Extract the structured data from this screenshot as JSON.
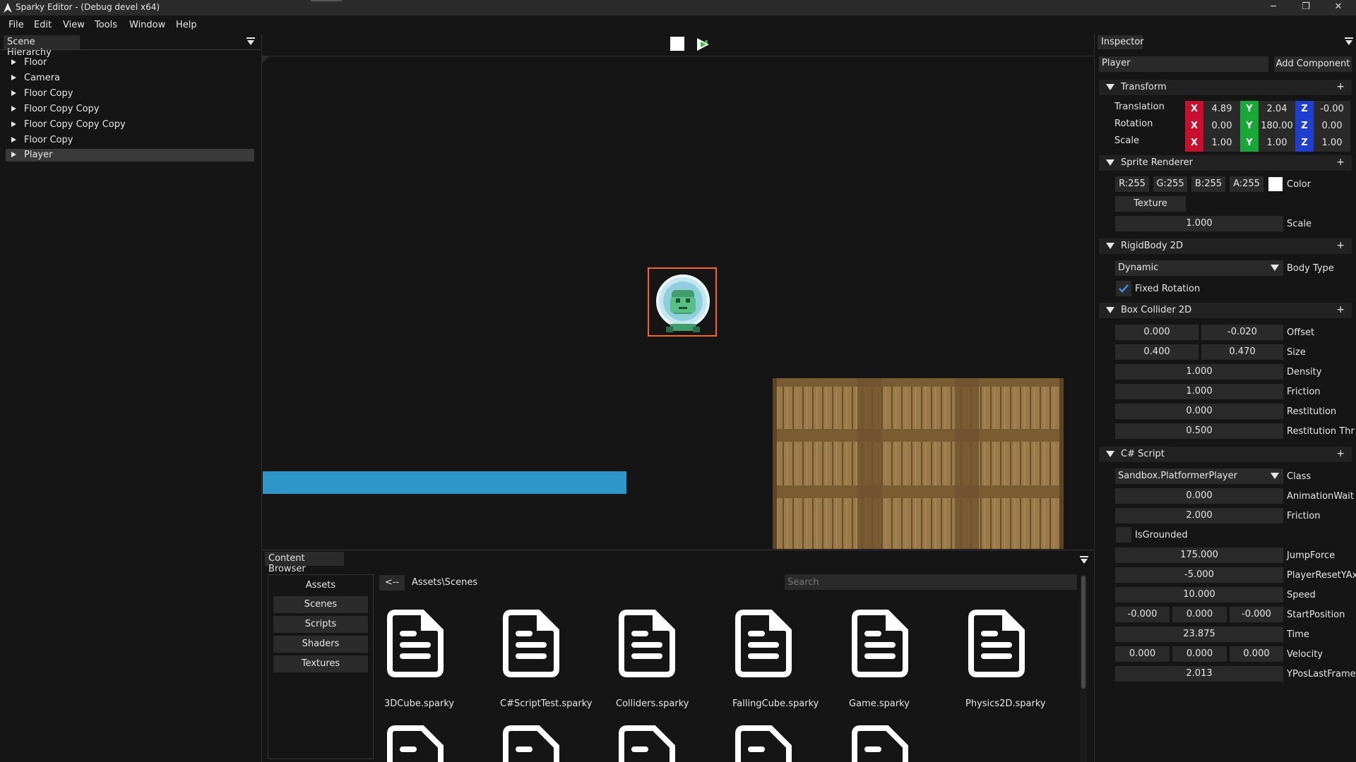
{
  "window": {
    "title": "Sparky Editor - (Debug devel x64)",
    "minimize": "─",
    "restore": "❐",
    "close": "✕"
  },
  "menu": {
    "items": [
      "File",
      "Edit",
      "View",
      "Tools",
      "Window",
      "Help"
    ]
  },
  "hierarchy": {
    "title": "Scene Hierarchy",
    "items": [
      "Floor",
      "Camera",
      "Floor Copy",
      "Floor Copy Copy",
      "Floor Copy Copy Copy",
      "Floor Copy",
      "Player"
    ],
    "selected": "Player"
  },
  "toolbar": {
    "stop_icon": "stop-icon",
    "play_icon": "simulate-icon"
  },
  "inspector": {
    "title": "Inspector",
    "entity_name": "Player",
    "add_component": "Add Component",
    "transform": {
      "title": "Transform",
      "plus": "+",
      "rows": [
        {
          "label": "Translation",
          "x": "4.89",
          "y": "2.04",
          "z": "-0.00"
        },
        {
          "label": "Rotation",
          "x": "0.00",
          "y": "180.00",
          "z": "0.00"
        },
        {
          "label": "Scale",
          "x": "1.00",
          "y": "1.00",
          "z": "1.00"
        }
      ],
      "axis_x": "X",
      "axis_y": "Y",
      "axis_z": "Z"
    },
    "sprite": {
      "title": "Sprite Renderer",
      "plus": "+",
      "r": "R:255",
      "g": "G:255",
      "b": "B:255",
      "a": "A:255",
      "color_label": "Color",
      "texture": "Texture",
      "scale_value": "1.000",
      "scale_label": "Scale",
      "swatch_color": "#ffffff"
    },
    "rigidbody": {
      "title": "RigidBody 2D",
      "plus": "+",
      "body_type": "Dynamic",
      "body_type_label": "Body Type",
      "fixed_rotation": "Fixed Rotation",
      "fixed_rotation_checked": true
    },
    "collider": {
      "title": "Box Collider 2D",
      "plus": "+",
      "offset_x": "0.000",
      "offset_y": "-0.020",
      "offset_label": "Offset",
      "size_x": "0.400",
      "size_y": "0.470",
      "size_label": "Size",
      "density": "1.000",
      "density_label": "Density",
      "friction": "1.000",
      "friction_label": "Friction",
      "restitution": "0.000",
      "restitution_label": "Restitution",
      "restitution_thr": "0.500",
      "restitution_thr_label": "Restitution Thr"
    },
    "script": {
      "title": "C# Script",
      "plus": "+",
      "class_value": "Sandbox.PlatformerPlayer",
      "class_label": "Class",
      "animation_wait": "0.000",
      "animation_wait_label": "AnimationWait",
      "friction": "2.000",
      "friction_label": "Friction",
      "is_grounded_label": "IsGrounded",
      "is_grounded_checked": false,
      "jump_force": "175.000",
      "jump_force_label": "JumpForce",
      "player_reset": "-5.000",
      "player_reset_label": "PlayerResetYAx",
      "speed": "10.000",
      "speed_label": "Speed",
      "start_x": "-0.000",
      "start_y": "0.000",
      "start_z": "-0.000",
      "start_label": "StartPosition",
      "time": "23.875",
      "time_label": "Time",
      "vel_x": "0.000",
      "vel_y": "0.000",
      "vel_z": "0.000",
      "vel_label": "Velocity",
      "ypos": "2.013",
      "ypos_label": "YPosLastFrame"
    }
  },
  "content_browser": {
    "title": "Content Browser",
    "root": "Assets",
    "dirs": [
      "Scenes",
      "Scripts",
      "Shaders",
      "Textures"
    ],
    "back": "<--",
    "path": "Assets\\Scenes",
    "search_placeholder": "Search",
    "files": [
      "3DCube.sparky",
      "C#ScriptTest.sparky",
      "Colliders.sparky",
      "FallingCube.sparky",
      "Game.sparky",
      "Physics2D.sparky"
    ]
  },
  "colors": {
    "accent_selection": "#ff6a00",
    "platform_blue": "#2e96c8",
    "axis_x": "#c8102e",
    "axis_y": "#18a835",
    "axis_z": "#1e3fd0"
  }
}
